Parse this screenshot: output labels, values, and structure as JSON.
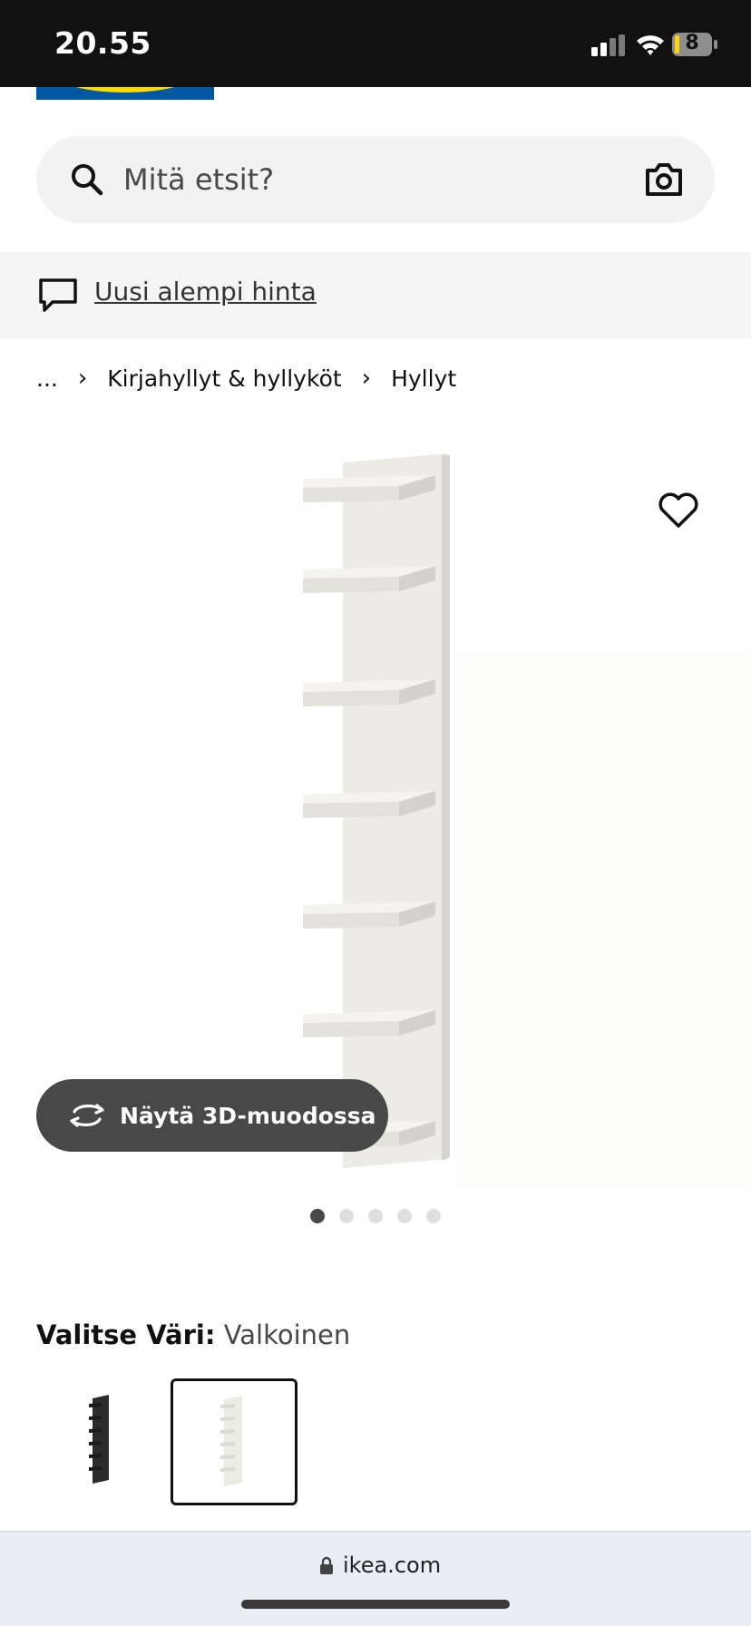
{
  "status_bar": {
    "time": "20.55",
    "battery_level": "8"
  },
  "search": {
    "placeholder": "Mitä etsit?"
  },
  "promo": {
    "link_text": "Uusi alempi hinta"
  },
  "breadcrumb": {
    "ellipsis": "...",
    "items": [
      "Kirjahyllyt & hyllyköt",
      "Hyllyt"
    ],
    "separator": "›"
  },
  "gallery": {
    "view_3d_label": "Näytä 3D-muodossa",
    "image_count": 5,
    "active_index": 0
  },
  "color_picker": {
    "label": "Valitse Väri:",
    "selected_value": "Valkoinen",
    "options": [
      "black",
      "white"
    ],
    "selected_option": "white"
  },
  "browser": {
    "url": "ikea.com"
  },
  "colors": {
    "brand_blue": "#0058a3",
    "brand_yellow": "#ffdb00",
    "button_dark": "#484848"
  }
}
